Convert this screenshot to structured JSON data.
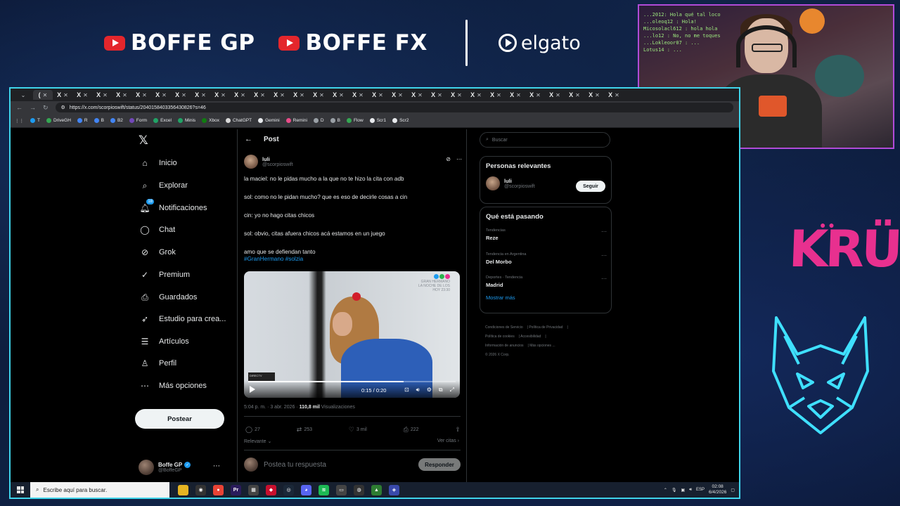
{
  "overlay": {
    "brands": [
      {
        "label": "BOFFE GP"
      },
      {
        "label": "BOFFE FX"
      }
    ],
    "sponsor": "elgato",
    "team_logo_text": "KRÜ",
    "webcam_chat": [
      "...2012: Hola qué tal loco",
      "...oleoq12 : Hola!",
      "Micosolacl612 : hola hola",
      "...lo12 : No, no me toques",
      "...Lokleoor07 : ...",
      "Lotus14 : ..."
    ]
  },
  "browser": {
    "url": "https://x.com/scorpioswift/status/2040158403356430826?s=46",
    "bookmarks": [
      "T",
      "DriveGH",
      "R",
      "B",
      "B2",
      "Form",
      "Excel",
      "Minis",
      "Xbox",
      "ChatGPT",
      "Gemini",
      "Remini",
      "D",
      "B",
      "Flow",
      "Scr1",
      "Scr2"
    ]
  },
  "nav": {
    "items": [
      {
        "label": "Inicio",
        "icon": "home-icon"
      },
      {
        "label": "Explorar",
        "icon": "search-icon"
      },
      {
        "label": "Notificaciones",
        "icon": "bell-icon",
        "badge": "18"
      },
      {
        "label": "Chat",
        "icon": "chat-icon"
      },
      {
        "label": "Grok",
        "icon": "grok-icon"
      },
      {
        "label": "Premium",
        "icon": "premium-icon"
      },
      {
        "label": "Guardados",
        "icon": "bookmark-icon"
      },
      {
        "label": "Estudio para crea...",
        "icon": "rocket-icon"
      },
      {
        "label": "Artículos",
        "icon": "article-icon"
      },
      {
        "label": "Perfil",
        "icon": "person-icon"
      },
      {
        "label": "Más opciones",
        "icon": "more-icon"
      }
    ],
    "post_button": "Postear",
    "profile": {
      "name": "Boffe GP",
      "handle": "@BoffeGP"
    }
  },
  "main": {
    "header_title": "Post",
    "tweet": {
      "author_name": "luli",
      "author_handle": "@scorpioswift",
      "lines": [
        "la maciel: no le pidas mucho a la que no te hizo la cita con adb",
        "sol: como no le pidan mucho? que es eso de decirle cosas a cin",
        "cin: yo no hago citas chicos",
        "sol: obvio, citas afuera chicos acá estamos en un juego",
        "amo que se defiendan tanto"
      ],
      "hashtags": "#GranHermano #solzia",
      "video": {
        "time": "0:15 / 0:20",
        "progress": 0.75,
        "watermark_1": "GRAN HERMANO",
        "watermark_2": "LA NOCHE DE LOS",
        "watermark_3": "HOY 23:30",
        "tag": "DIRECTV"
      },
      "timestamp": "5:04 p. m. · 3 abr. 2026 · ",
      "views_count": "110,8 mil",
      "views_label": " Visualizaciones",
      "replies": "27",
      "reposts": "253",
      "likes": "3 mil",
      "bookmarks": "222",
      "sort_label": "Relevante",
      "quotes_label": "Ver citas"
    },
    "reply_placeholder": "Postea tu respuesta",
    "reply_button": "Responder"
  },
  "right": {
    "search_placeholder": "Buscar",
    "relevant_title": "Personas relevantes",
    "relevant_user": {
      "name": "luli",
      "handle": "@scorpioswift"
    },
    "follow_label": "Seguir",
    "trends_title": "Qué está pasando",
    "trends": [
      {
        "context": "Tendencias",
        "name": "Reze"
      },
      {
        "context": "Tendencia en Argentina",
        "name": "Del Morbo"
      },
      {
        "context": "Deportes · Tendencia",
        "name": "Madrid"
      }
    ],
    "show_more": "Mostrar más",
    "footer": [
      "Condiciones de Servicio",
      "Política de Privacidad",
      "Política de cookies",
      "Accesibilidad",
      "Información de anuncios",
      "Más opciones ...",
      "© 2026 X Corp."
    ]
  },
  "taskbar": {
    "search_placeholder": "Escribe aquí para buscar.",
    "language": "ESP",
    "time": "02:08",
    "date": "6/4/2026"
  },
  "colors": {
    "accent": "#1d9bf0",
    "frame": "#3fd4ea",
    "webcam_border": "#b14bd8",
    "team_pink": "#e8308f"
  }
}
